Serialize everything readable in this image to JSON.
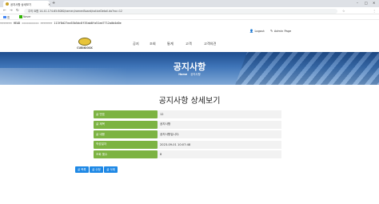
{
  "browser": {
    "tab_title": "공지사항 상세보기",
    "tab_close": "×",
    "new_tab": "+",
    "window_controls": [
      "–",
      "□",
      "✕"
    ],
    "nav": [
      "←",
      "→",
      "↻"
    ],
    "url": "주의 요함   14.41.174.65:8080/ramen/ramenBoard/noticeDetail.do?no=12",
    "omni_icons": [
      "☆",
      "⋮"
    ],
    "bookmarks": [
      {
        "label": "앱",
        "color": "#4285f4"
      },
      {
        "label": "Naver",
        "color": "#2db400"
      }
    ]
  },
  "page": {
    "conflict_text": "<<<<<<< HEAD ========== >>>>>>> 113f8d27ea55b5dc8f35ab8fa51ed7712a0d4d0e",
    "topbar": {
      "logout_icon": "👤",
      "logout": "Logout",
      "mypage_icon": "✎",
      "mypage": "Admin Page"
    },
    "logo_text": "CUBIKIOSK",
    "gnb": [
      "공지",
      "조회",
      "통계",
      "고객",
      "고객의견"
    ],
    "hero": {
      "title": "공지사항",
      "crumb_home": "Home",
      "crumb_current": "공지사항"
    },
    "title": "공지사항 상세보기",
    "fields": [
      {
        "label": "글 번호",
        "value": "12"
      },
      {
        "label": "글 제목",
        "value": "공지사항"
      },
      {
        "label": "글 내용",
        "value": "공지사항입니다."
      },
      {
        "label": "작성일자",
        "value": "2023-09-01 10:07:48"
      },
      {
        "label": "조회 횟수",
        "value": "8"
      }
    ],
    "buttons": [
      "글 목록",
      "글 수정",
      "글 삭제"
    ]
  }
}
